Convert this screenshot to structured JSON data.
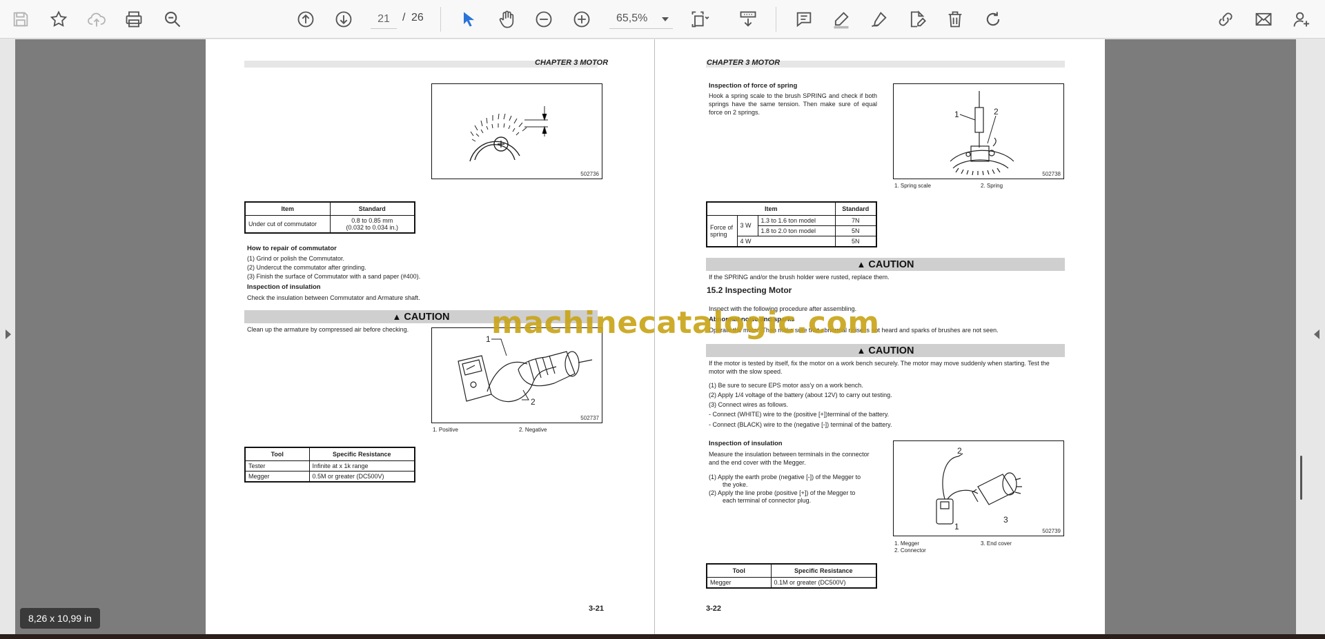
{
  "toolbar": {
    "page_current": "21",
    "page_separator": "/",
    "page_total": "26",
    "zoom": "65,5%"
  },
  "size_tag": "8,26 x 10,99 in",
  "watermark": "machinecatalogic.com",
  "left_page": {
    "chapter": "CHAPTER 3 MOTOR",
    "fig1_id": "502736",
    "table1": {
      "headers": [
        "Item",
        "Standard"
      ],
      "row": [
        "Under cut of commutator",
        "0.8 to 0.85 mm",
        "(0.032 to 0.034 in.)"
      ]
    },
    "repair_title": "How to repair of commutator",
    "repair_steps": [
      "(1)   Grind or polish the Commutator.",
      "(2)   Undercut the commutator after grinding.",
      "(3)   Finish the surface of Commutator with a sand paper (#400)."
    ],
    "insulation_title": "Inspection of insulation",
    "insulation_text": "Check the insulation between Commutator and Armature shaft.",
    "caution": "CAUTION",
    "caution_text": "Clean up the armature by compressed air before checking.",
    "fig2_id": "502737",
    "fig2_label1": "1",
    "fig2_label2": "2",
    "fig2_cap1": "1. Positive",
    "fig2_cap2": "2. Negative",
    "table2": {
      "headers": [
        "Tool",
        "Specific Resistance"
      ],
      "rows": [
        [
          "Tester",
          "Infinite at x 1k range"
        ],
        [
          "Megger",
          "0.5M or greater (DC500V)"
        ]
      ]
    },
    "page_number": "3-21"
  },
  "right_page": {
    "chapter": "CHAPTER 3 MOTOR",
    "spring_title": "Inspection of force of spring",
    "spring_text": "Hook a spring scale to the brush SPRING and check if both springs have the same tension. Then make sure of equal force on 2 springs.",
    "fig3_id": "502738",
    "fig3_label1": "1",
    "fig3_label2": "2",
    "fig3_cap1": "1. Spring scale",
    "fig3_cap2": "2. Spring",
    "table3": {
      "headers": [
        "Item",
        "Standard"
      ],
      "force_label": "Force of spring",
      "w3": "3 W",
      "w4": "4 W",
      "r1": [
        "1.3 to 1.6 ton model",
        "7N"
      ],
      "r2": [
        "1.8 to 2.0 ton model",
        "5N"
      ],
      "r3": "5N"
    },
    "caution1": "CAUTION",
    "caution1_text": "If the SPRING and/or the brush holder were rusted, replace them.",
    "section_title": "15.2    Inspecting Motor",
    "inspect_text": "Inspect with the following procedure after assembling.",
    "noise_title": "Abnormal noise and sparks",
    "noise_text": "Operate the motor. Then make sure that abnormal noise is not heard and sparks of brushes are not seen.",
    "caution2": "CAUTION",
    "caution2_text": "If the motor is tested by itself, fix the motor on a work bench securely. The motor may move suddenly when starting. Test the motor with the slow speed.",
    "steps": [
      "(1)    Be sure to secure EPS motor ass'y on a work bench.",
      "(2)    Apply 1/4 voltage of the battery (about 12V) to carry out testing.",
      "(3)    Connect wires as follows.",
      "-        Connect (WHITE) wire to the (positive [+])terminal of the battery.",
      "-        Connect (BLACK) wire to the (negative [-]) terminal of the battery."
    ],
    "ins_title": "Inspection of insulation",
    "ins_text": "Measure the insulation between terminals in the connector and the end cover with the Megger.",
    "ins_step1a": "(1)    Apply the earth probe (negative [-]) of the Megger to",
    "ins_step1b": "the yoke.",
    "ins_step2a": "(2)    Apply the line probe (positive [+]) of the Megger to",
    "ins_step2b": "each terminal of connector plug.",
    "fig4_id": "502739",
    "fig4_label1": "1",
    "fig4_label2": "2",
    "fig4_label3": "3",
    "fig4_cap1": "1. Megger",
    "fig4_cap2": "2. Connector",
    "fig4_cap3": "3. End cover",
    "table4": {
      "headers": [
        "Tool",
        "Specific Resistance"
      ],
      "row": [
        "Megger",
        "0.1M or greater (DC500V)"
      ]
    },
    "page_number": "3-22"
  },
  "colors": {
    "toolbar_bg": "#f8f8f8",
    "active_tool": "#2a73d8",
    "side_band": "#7c7c7c",
    "watermark": "#c9a51b",
    "caution_bar": "#cfcfcf"
  }
}
